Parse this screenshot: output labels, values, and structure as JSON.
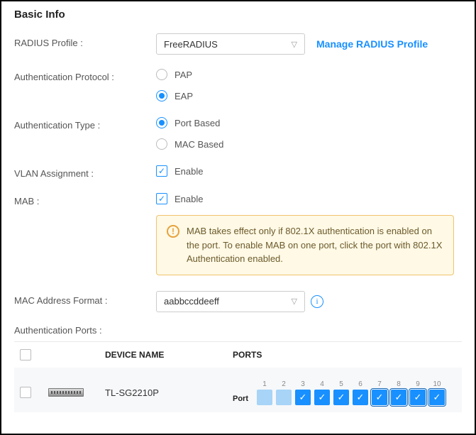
{
  "section_title": "Basic Info",
  "radius": {
    "label": "RADIUS Profile :",
    "value": "FreeRADIUS",
    "manage_link": "Manage RADIUS Profile"
  },
  "auth_protocol": {
    "label": "Authentication Protocol :",
    "options": {
      "pap": "PAP",
      "eap": "EAP"
    },
    "selected": "eap"
  },
  "auth_type": {
    "label": "Authentication Type :",
    "options": {
      "port": "Port Based",
      "mac": "MAC Based"
    },
    "selected": "port"
  },
  "vlan": {
    "label": "VLAN Assignment :",
    "text": "Enable",
    "checked": true
  },
  "mab": {
    "label": "MAB :",
    "text": "Enable",
    "checked": true,
    "alert": "MAB takes effect only if 802.1X authentication is enabled on the port. To enable MAB on one port, click the port with 802.1X Authentication enabled."
  },
  "mac_format": {
    "label": "MAC Address Format :",
    "value": "aabbccddeeff"
  },
  "auth_ports_label": "Authentication Ports :",
  "table": {
    "headers": {
      "device": "DEVICE NAME",
      "ports": "PORTS"
    },
    "row": {
      "device_name": "TL-SG2210P",
      "port_label": "Port",
      "ports": [
        {
          "n": "1",
          "state": "plain"
        },
        {
          "n": "2",
          "state": "plain"
        },
        {
          "n": "3",
          "state": "checked"
        },
        {
          "n": "4",
          "state": "checked"
        },
        {
          "n": "5",
          "state": "checked"
        },
        {
          "n": "6",
          "state": "checked"
        },
        {
          "n": "7",
          "state": "outlined"
        },
        {
          "n": "8",
          "state": "outlined"
        },
        {
          "n": "9",
          "state": "outlined"
        },
        {
          "n": "10",
          "state": "outlined"
        }
      ]
    }
  }
}
